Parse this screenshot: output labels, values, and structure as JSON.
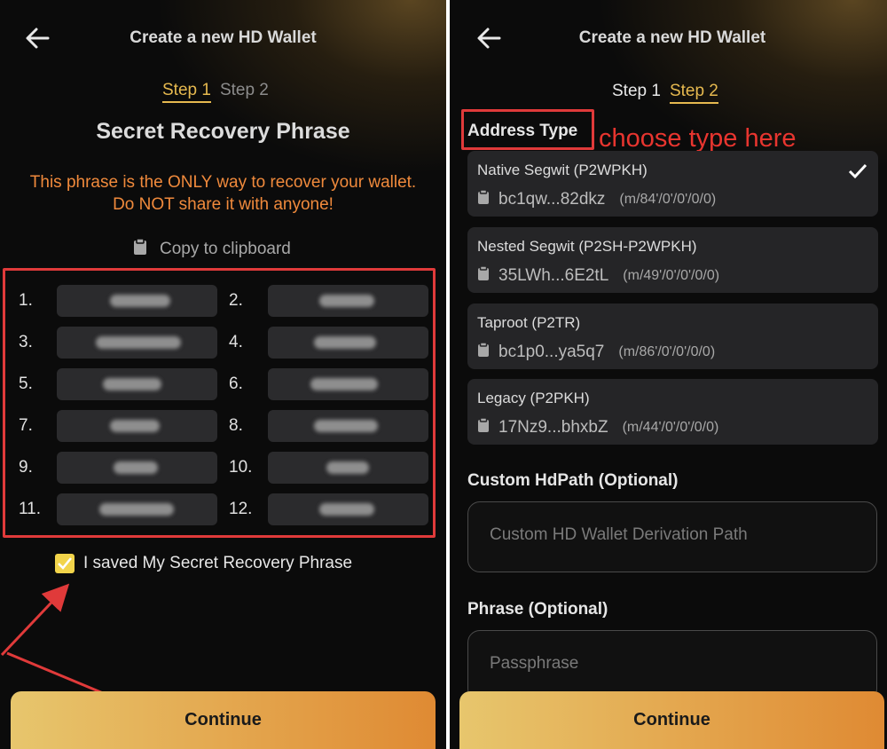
{
  "left": {
    "header_title": "Create a new HD Wallet",
    "steps": [
      "Step 1",
      "Step 2"
    ],
    "title": "Secret Recovery Phrase",
    "warning": "This phrase is the ONLY way to recover your wallet. Do NOT share it with anyone!",
    "copy_label": "Copy to clipboard",
    "words": [
      {
        "num": "1."
      },
      {
        "num": "2."
      },
      {
        "num": "3."
      },
      {
        "num": "4."
      },
      {
        "num": "5."
      },
      {
        "num": "6."
      },
      {
        "num": "7."
      },
      {
        "num": "8."
      },
      {
        "num": "9."
      },
      {
        "num": "10."
      },
      {
        "num": "11."
      },
      {
        "num": "12."
      }
    ],
    "saved_label": "I saved My Secret Recovery Phrase",
    "saved_checked": true,
    "continue_label": "Continue"
  },
  "right": {
    "header_title": "Create a new HD Wallet",
    "steps": [
      "Step 1",
      "Step 2"
    ],
    "address_type_label": "Address Type",
    "annotation": "choose type here",
    "address_types": [
      {
        "name": "Native Segwit (P2WPKH)",
        "address": "bc1qw...82dkz",
        "path": "(m/84'/0'/0'/0/0)",
        "selected": true
      },
      {
        "name": "Nested Segwit (P2SH-P2WPKH)",
        "address": "35LWh...6E2tL",
        "path": "(m/49'/0'/0'/0/0)",
        "selected": false
      },
      {
        "name": "Taproot (P2TR)",
        "address": "bc1p0...ya5q7",
        "path": "(m/86'/0'/0'/0/0)",
        "selected": false
      },
      {
        "name": "Legacy (P2PKH)",
        "address": "17Nz9...bhxbZ",
        "path": "(m/44'/0'/0'/0/0)",
        "selected": false
      }
    ],
    "custom_hdpath_label": "Custom HdPath (Optional)",
    "custom_hdpath_placeholder": "Custom HD Wallet Derivation Path",
    "phrase_label": "Phrase (Optional)",
    "phrase_placeholder": "Passphrase",
    "continue_label": "Continue"
  },
  "colors": {
    "accent": "#e6b94f",
    "warning": "#f08a3c",
    "annotation": "#e03a3a",
    "card": "#252527"
  },
  "icons": [
    "back-arrow-icon",
    "clipboard-icon",
    "checkmark-icon"
  ]
}
